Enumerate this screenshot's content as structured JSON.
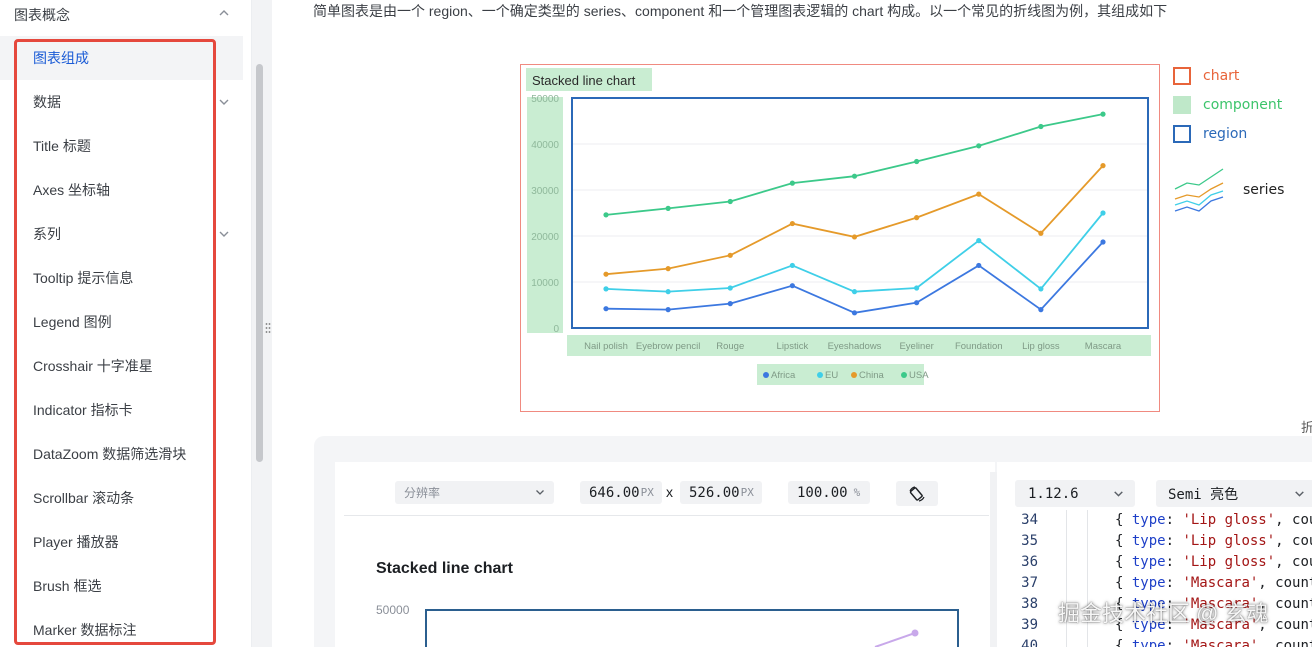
{
  "sidebar": {
    "group_label": "图表概念",
    "items": [
      {
        "label": "图表组成",
        "active": true,
        "expandable": false
      },
      {
        "label": "数据",
        "active": false,
        "expandable": true
      },
      {
        "label": "Title 标题",
        "active": false,
        "expandable": false
      },
      {
        "label": "Axes 坐标轴",
        "active": false,
        "expandable": false
      },
      {
        "label": "系列",
        "active": false,
        "expandable": true
      },
      {
        "label": "Tooltip 提示信息",
        "active": false,
        "expandable": false
      },
      {
        "label": "Legend 图例",
        "active": false,
        "expandable": false
      },
      {
        "label": "Crosshair 十字准星",
        "active": false,
        "expandable": false
      },
      {
        "label": "Indicator 指标卡",
        "active": false,
        "expandable": false
      },
      {
        "label": "DataZoom 数据筛选滑块",
        "active": false,
        "expandable": false
      },
      {
        "label": "Scrollbar 滚动条",
        "active": false,
        "expandable": false
      },
      {
        "label": "Player 播放器",
        "active": false,
        "expandable": false
      },
      {
        "label": "Brush 框选",
        "active": false,
        "expandable": false
      },
      {
        "label": "Marker 数据标注",
        "active": false,
        "expandable": false
      }
    ]
  },
  "intro_text": "简单图表是由一个 region、一个确定类型的 series、component 和一个管理图表逻辑的 chart 构成。以一个常见的折线图为例，其组成如下",
  "cut_char": "折",
  "diagram": {
    "chart_title": "Stacked line chart",
    "legend_keys": [
      {
        "label": "chart",
        "color": "#e8643a"
      },
      {
        "label": "component",
        "color": "#3cc46b"
      },
      {
        "label": "region",
        "color": "#2b69b8"
      },
      {
        "label": "series",
        "color": "#222222"
      }
    ],
    "legend_items": [
      "Africa",
      "EU",
      "China",
      "USA"
    ]
  },
  "chart_data": {
    "type": "line",
    "title": "Stacked line chart",
    "categories": [
      "Nail polish",
      "Eyebrow pencil",
      "Rouge",
      "Lipstick",
      "Eyeshadows",
      "Eyeliner",
      "Foundation",
      "Lip gloss",
      "Mascara"
    ],
    "yticks": [
      "50000",
      "40000",
      "30000",
      "20000",
      "10000",
      "0"
    ],
    "ylim": [
      0,
      50000
    ],
    "series": [
      {
        "name": "Africa",
        "color": "#3c78e0",
        "values": [
          4200,
          4000,
          5300,
          9200,
          3300,
          5500,
          13600,
          4000,
          18700
        ]
      },
      {
        "name": "EU",
        "color": "#3fcfe8",
        "values": [
          8500,
          7900,
          8700,
          13600,
          7900,
          8700,
          19000,
          8500,
          25000
        ]
      },
      {
        "name": "China",
        "color": "#e59a2a",
        "values": [
          11700,
          12900,
          15800,
          22700,
          19800,
          24000,
          29100,
          20600,
          35300
        ]
      },
      {
        "name": "USA",
        "color": "#3cc98a",
        "values": [
          24600,
          26000,
          27500,
          31500,
          33000,
          36200,
          39600,
          43800,
          46500
        ]
      }
    ]
  },
  "playground": {
    "resolution_placeholder": "分辨率",
    "width_value": "646.00",
    "height_value": "526.00",
    "unit_px": "PX",
    "times": "x",
    "zoom_value": "100.00",
    "zoom_unit": "%",
    "version": "1.12.6",
    "theme": "Semi 亮色",
    "preview_title": "Stacked line chart",
    "preview_ytick": "50000"
  },
  "code_lines": [
    {
      "n": "34",
      "type": "'Lip gloss'",
      "tail": ", cou"
    },
    {
      "n": "35",
      "type": "'Lip gloss'",
      "tail": ", cou"
    },
    {
      "n": "36",
      "type": "'Lip gloss'",
      "tail": ", cou"
    },
    {
      "n": "37",
      "type": "'Mascara'",
      "tail": ", count"
    },
    {
      "n": "38",
      "type": "'Mascara'",
      "tail": ", count"
    },
    {
      "n": "39",
      "type": "'Mascara'",
      "tail": ", count"
    },
    {
      "n": "40",
      "type": "'Mascara'",
      "tail": ", count"
    }
  ],
  "watermark": "掘金技术社区 @ 玄魂"
}
